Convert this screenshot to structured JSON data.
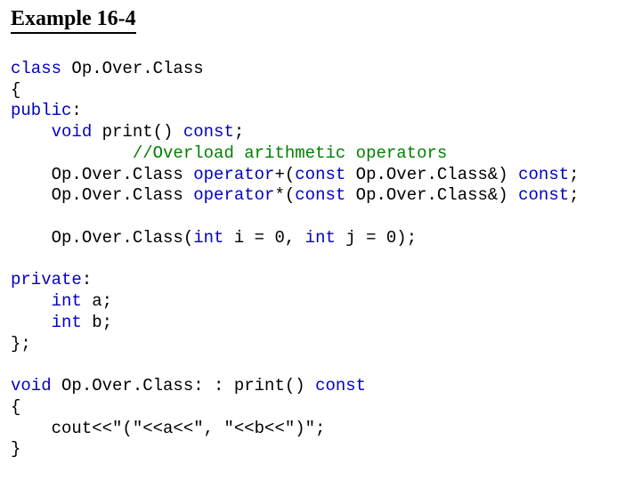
{
  "title": "Example 16-4",
  "code": {
    "l1a": "class",
    "l1b": " Op.Over.Class",
    "l2": "{",
    "l3a": "public",
    "l3b": ":",
    "l4a": "    void",
    "l4b": " print() ",
    "l4c": "const",
    "l4d": ";",
    "l5": "            //Overload arithmetic operators",
    "l6a": "    Op.Over.Class ",
    "l6b": "operator",
    "l6c": "+(",
    "l6d": "const",
    "l6e": " Op.Over.Class&) ",
    "l6f": "const",
    "l6g": ";",
    "l7a": "    Op.Over.Class ",
    "l7b": "operator",
    "l7c": "*(",
    "l7d": "const",
    "l7e": " Op.Over.Class&) ",
    "l7f": "const",
    "l7g": ";",
    "l8a": "    Op.Over.Class(",
    "l8b": "int",
    "l8c": " i = 0, ",
    "l8d": "int",
    "l8e": " j = 0);",
    "l9a": "private",
    "l9b": ":",
    "l10a": "    int",
    "l10b": " a;",
    "l11a": "    int",
    "l11b": " b;",
    "l12": "};",
    "l13a": "void",
    "l13b": " Op.Over.Class: : print() ",
    "l13c": "const",
    "l14": "{",
    "l15": "    cout<<\"(\"<<a<<\", \"<<b<<\")\";",
    "l16": "}"
  }
}
